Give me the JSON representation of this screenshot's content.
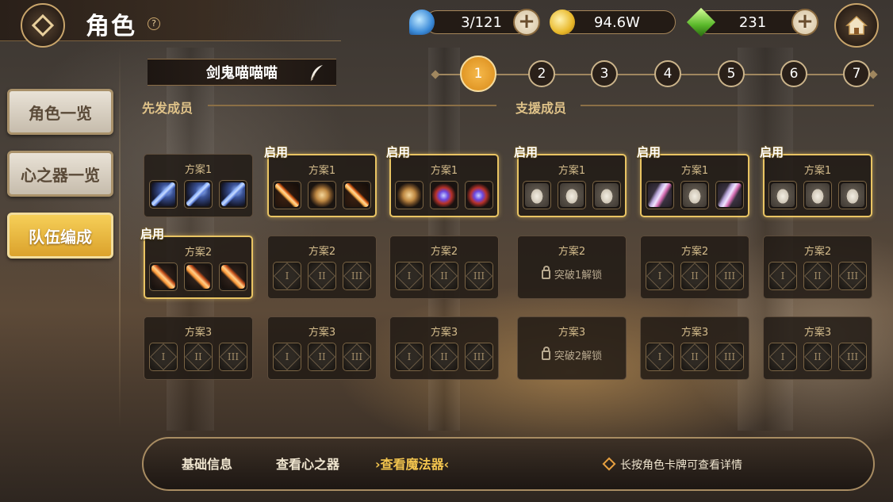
{
  "header": {
    "title": "角色",
    "help": "?"
  },
  "resources": {
    "stamina": "3/121",
    "gold": "94.6W",
    "gems": "231"
  },
  "nav": [
    {
      "label": "角色一览",
      "active": false
    },
    {
      "label": "心之器一览",
      "active": false
    },
    {
      "label": "队伍编成",
      "active": true
    }
  ],
  "team": {
    "name": "剑鬼喵喵喵"
  },
  "tabs": [
    "1",
    "2",
    "3",
    "4",
    "5",
    "6",
    "7"
  ],
  "sections": {
    "starters": "先发成员",
    "support": "支援成员"
  },
  "enabled_badge": "启用",
  "members": [
    {
      "plans": [
        {
          "label": "方案1",
          "enabled": false,
          "slots": [
            "wpn-blue",
            "wpn-blue",
            "wpn-blue"
          ]
        },
        {
          "label": "方案2",
          "enabled": true,
          "slots": [
            "wpn-orange",
            "wpn-orange",
            "wpn-orange"
          ]
        },
        {
          "label": "方案3",
          "enabled": false,
          "slots": [
            "I",
            "II",
            "III"
          ]
        }
      ]
    },
    {
      "plans": [
        {
          "label": "方案1",
          "enabled": true,
          "slots": [
            "wpn-fire",
            "wpn-shield",
            "wpn-fire"
          ]
        },
        {
          "label": "方案2",
          "enabled": false,
          "slots": [
            "I",
            "II",
            "III"
          ]
        },
        {
          "label": "方案3",
          "enabled": false,
          "slots": [
            "I",
            "II",
            "III"
          ]
        }
      ]
    },
    {
      "plans": [
        {
          "label": "方案1",
          "enabled": true,
          "slots": [
            "wpn-shield",
            "wpn-orb",
            "wpn-orb"
          ]
        },
        {
          "label": "方案2",
          "enabled": false,
          "slots": [
            "I",
            "II",
            "III"
          ]
        },
        {
          "label": "方案3",
          "enabled": false,
          "slots": [
            "I",
            "II",
            "III"
          ]
        }
      ]
    },
    {
      "plans": [
        {
          "label": "方案1",
          "enabled": true,
          "slots": [
            "wpn-vase",
            "wpn-vase",
            "wpn-vase"
          ]
        },
        {
          "label": "方案2",
          "enabled": false,
          "locked": "突破1解锁"
        },
        {
          "label": "方案3",
          "enabled": false,
          "locked": "突破2解锁"
        }
      ]
    },
    {
      "plans": [
        {
          "label": "方案1",
          "enabled": true,
          "slots": [
            "wpn-shell",
            "wpn-vase",
            "wpn-shell"
          ]
        },
        {
          "label": "方案2",
          "enabled": false,
          "slots": [
            "I",
            "II",
            "III"
          ]
        },
        {
          "label": "方案3",
          "enabled": false,
          "slots": [
            "I",
            "II",
            "III"
          ]
        }
      ]
    },
    {
      "plans": [
        {
          "label": "方案1",
          "enabled": true,
          "slots": [
            "wpn-vase",
            "wpn-vase",
            "wpn-vase"
          ]
        },
        {
          "label": "方案2",
          "enabled": false,
          "slots": [
            "I",
            "II",
            "III"
          ]
        },
        {
          "label": "方案3",
          "enabled": false,
          "slots": [
            "I",
            "II",
            "III"
          ]
        }
      ]
    }
  ],
  "bottom": {
    "basic_info": "基础信息",
    "view_heart": "查看心之器",
    "view_magic": "查看魔法器",
    "hint": "长按角色卡牌可查看详情"
  },
  "colors": {
    "accent": "#f2c44e",
    "enabled_border": "#e9c463",
    "active_tab": "#e89a22"
  }
}
